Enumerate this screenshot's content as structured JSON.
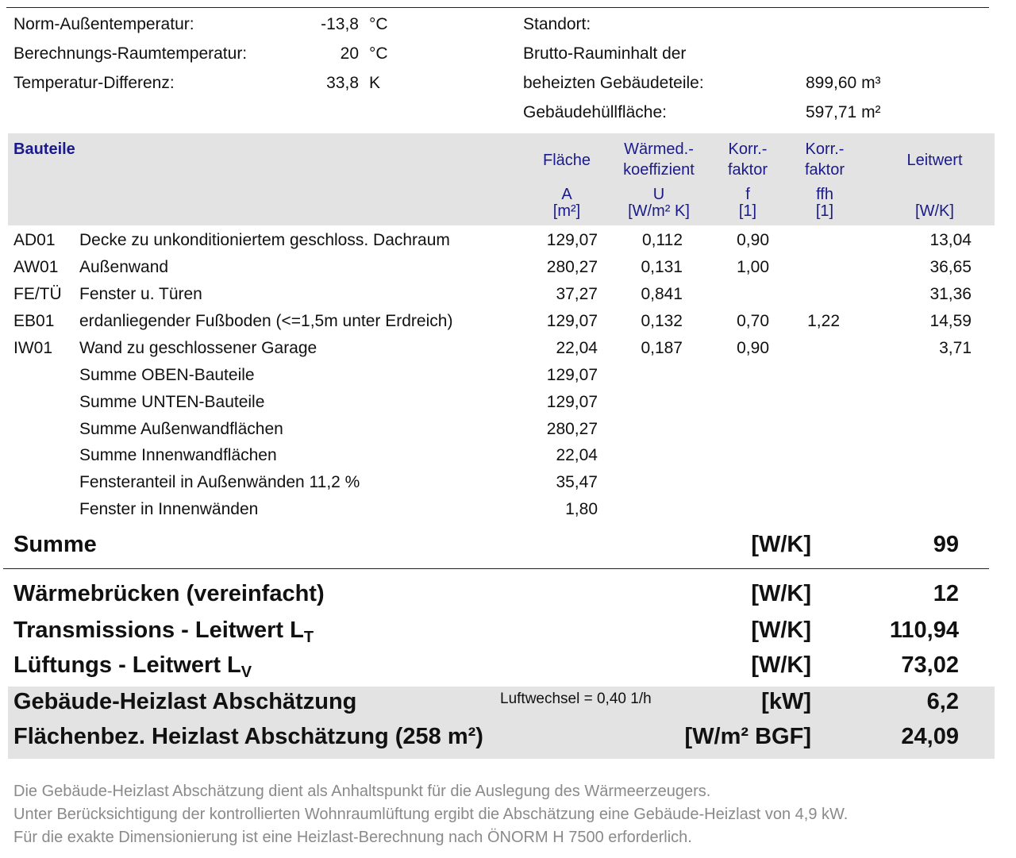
{
  "info_left": [
    {
      "label": "Norm-Außentemperatur:",
      "value": "-13,8",
      "unit": "°C"
    },
    {
      "label": "Berechnungs-Raumtemperatur:",
      "value": "20",
      "unit": "°C"
    },
    {
      "label": "Temperatur-Differenz:",
      "value": "33,8",
      "unit": "K"
    }
  ],
  "info_right": {
    "standort_label": "Standort:",
    "brutto_label_1": "Brutto-Rauminhalt der",
    "brutto_label_2": "beheizten Gebäudeteile:",
    "brutto_value": "899,60 m³",
    "huelle_label": "Gebäudehüllfläche:",
    "huelle_value": "597,71 m²"
  },
  "table": {
    "header": {
      "bauteile": "Bauteile",
      "flaeche": "Fläche",
      "flaeche_sym": "A",
      "flaeche_unit": "[m²]",
      "waermed_1": "Wärmed.-",
      "waermed_2": "koeffizient",
      "waermed_sym": "U",
      "waermed_unit": "[W/m² K]",
      "korr_f_1": "Korr.-",
      "korr_f_2": "faktor",
      "korr_f_sym": "f",
      "korr_f_unit": "[1]",
      "korr_ffh_1": "Korr.-",
      "korr_ffh_2": "faktor",
      "korr_ffh_sym": "ffh",
      "korr_ffh_unit": "[1]",
      "leitwert": "Leitwert",
      "leitwert_unit": "[W/K]"
    },
    "rows": [
      {
        "code": "AD01",
        "name": "Decke zu unkonditioniertem geschloss. Dachraum",
        "a": "129,07",
        "u": "0,112",
        "f": "0,90",
        "ffh": "",
        "l": "13,04"
      },
      {
        "code": "AW01",
        "name": "Außenwand",
        "a": "280,27",
        "u": "0,131",
        "f": "1,00",
        "ffh": "",
        "l": "36,65"
      },
      {
        "code": "FE/TÜ",
        "name": "Fenster u. Türen",
        "a": "37,27",
        "u": "0,841",
        "f": "",
        "ffh": "",
        "l": "31,36"
      },
      {
        "code": "EB01",
        "name": "erdanliegender Fußboden (<=1,5m unter Erdreich)",
        "a": "129,07",
        "u": "0,132",
        "f": "0,70",
        "ffh": "1,22",
        "l": "14,59"
      },
      {
        "code": "IW01",
        "name": "Wand zu geschlossener Garage",
        "a": "22,04",
        "u": "0,187",
        "f": "0,90",
        "ffh": "",
        "l": "3,71"
      }
    ],
    "sums": [
      {
        "name": "Summe OBEN-Bauteile",
        "a": "129,07"
      },
      {
        "name": "Summe UNTEN-Bauteile",
        "a": "129,07"
      },
      {
        "name": "Summe Außenwandflächen",
        "a": "280,27"
      },
      {
        "name": "Summe Innenwandflächen",
        "a": "22,04"
      },
      {
        "name": "Fensteranteil in Außenwänden 11,2 %",
        "a": "35,47"
      },
      {
        "name": "Fenster in Innenwänden",
        "a": "1,80"
      }
    ]
  },
  "results": {
    "summe": {
      "label": "Summe",
      "unit": "[W/K]",
      "value": "99"
    },
    "waermebruecken": {
      "label": "Wärmebrücken (vereinfacht)",
      "unit": "[W/K]",
      "value": "12"
    },
    "transmission": {
      "label": "Transmissions - Leitwert L",
      "sub": "T",
      "unit": "[W/K]",
      "value": "110,94"
    },
    "lueftung": {
      "label": "Lüftungs - Leitwert L",
      "sub": "V",
      "unit": "[W/K]",
      "value": "73,02"
    },
    "heizlast": {
      "label": "Gebäude-Heizlast Abschätzung",
      "note": "Luftwechsel = 0,40 1/h",
      "unit": "[kW]",
      "value": "6,2"
    },
    "flaechenbez": {
      "label": "Flächenbez. Heizlast Abschätzung (258 m²)",
      "unit": "[W/m² BGF]",
      "value": "24,09"
    }
  },
  "footer": [
    "Die Gebäude-Heizlast Abschätzung dient als Anhaltspunkt für die Auslegung des Wärmeerzeugers.",
    "Unter Berücksichtigung der kontrollierten Wohnraumlüftung ergibt die Abschätzung eine Gebäude-Heizlast von 4,9 kW.",
    "Für die exakte Dimensionierung ist eine Heizlast-Berechnung nach ÖNORM H 7500 erforderlich."
  ]
}
